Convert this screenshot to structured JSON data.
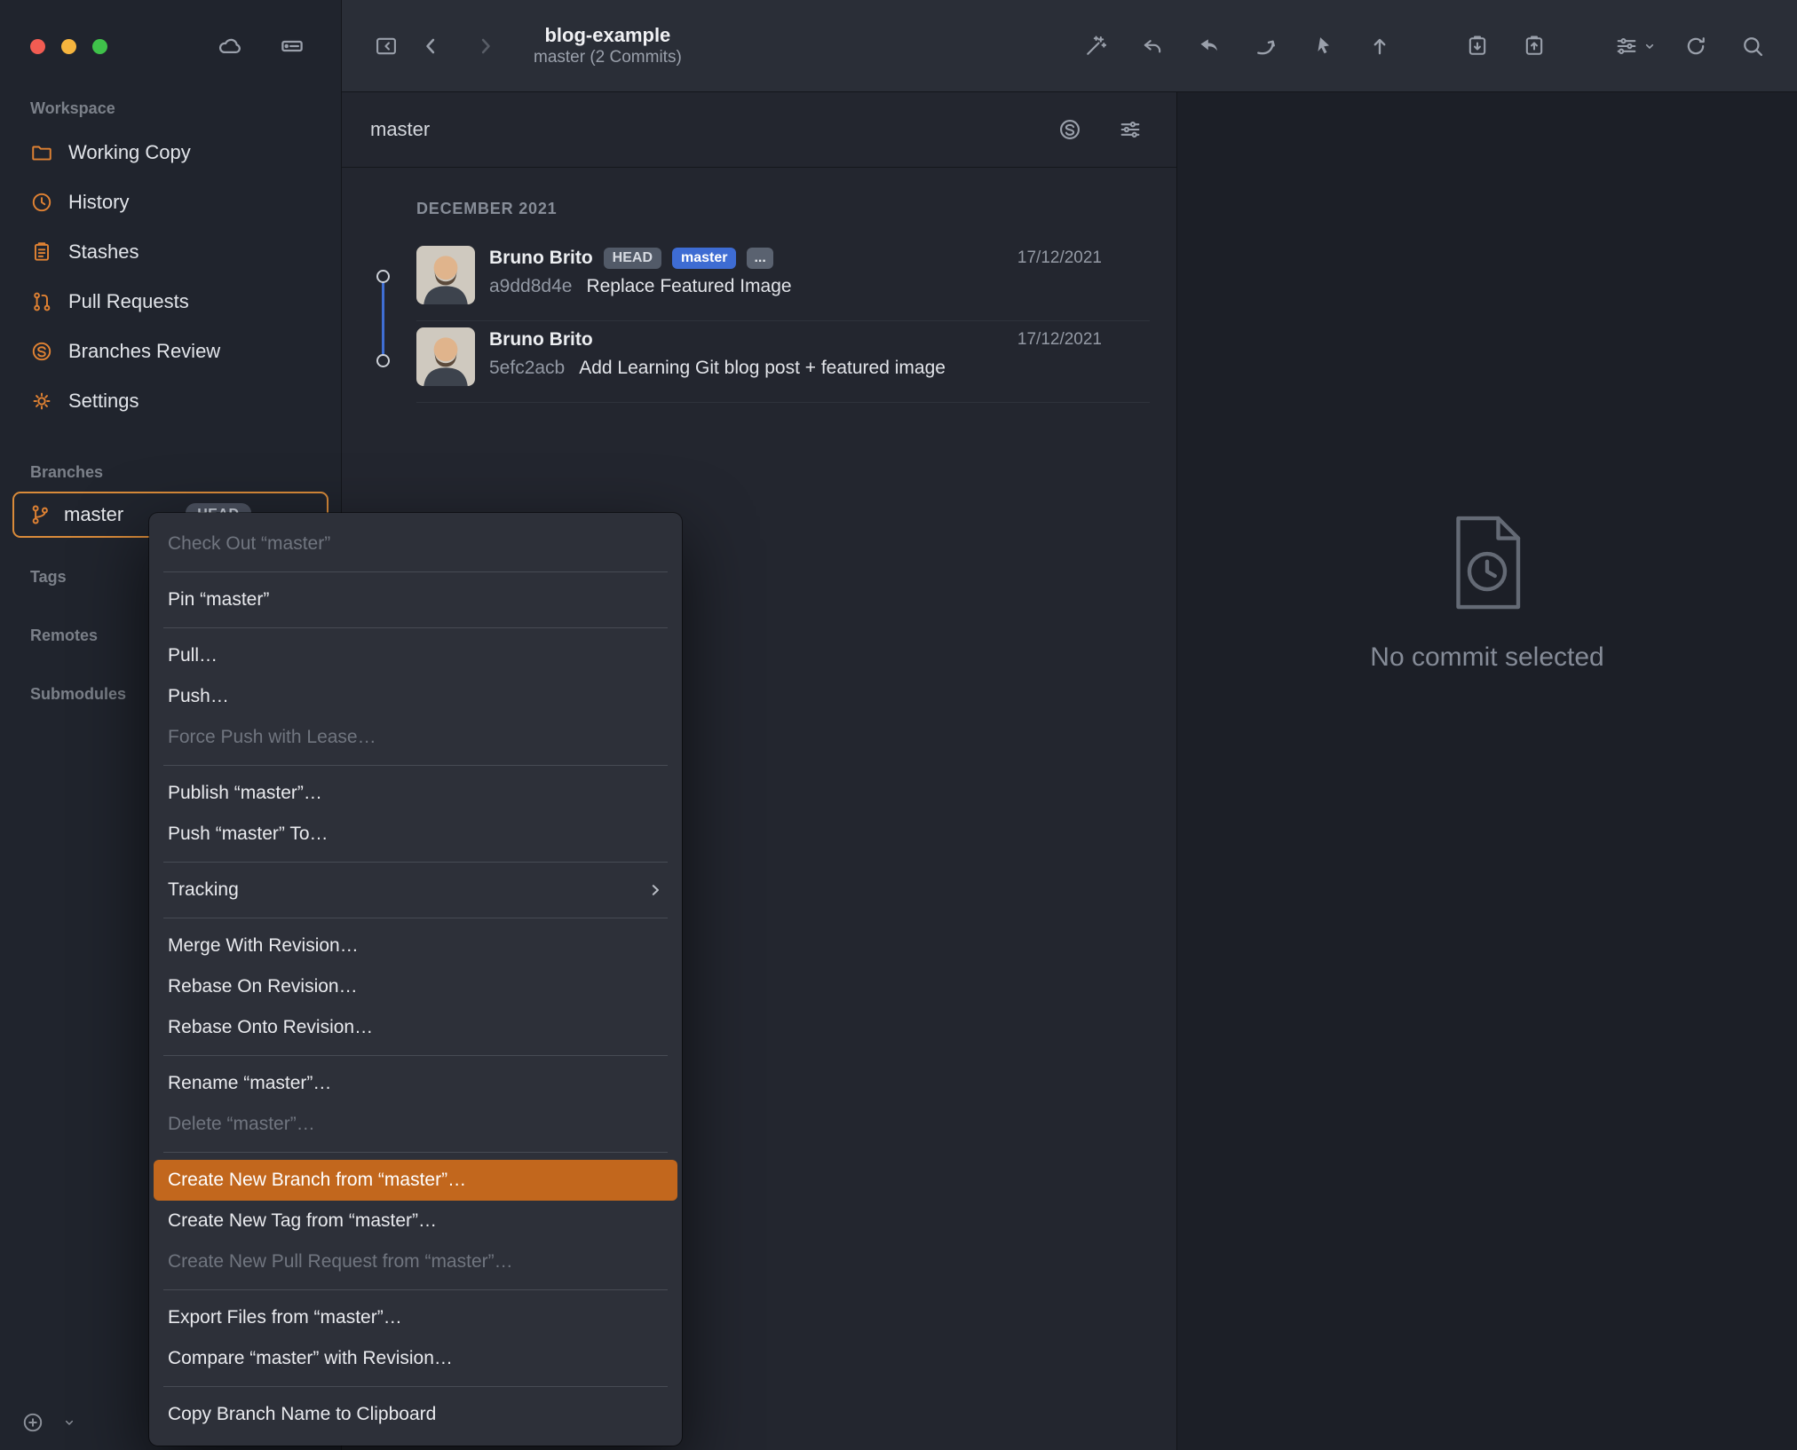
{
  "window": {
    "title": "blog-example",
    "subtitle": "master (2 Commits)"
  },
  "sidebar": {
    "sections": {
      "workspace": "Workspace",
      "branches": "Branches",
      "tags": "Tags",
      "remotes": "Remotes",
      "submodules": "Submodules"
    },
    "workspace_items": [
      {
        "label": "Working Copy",
        "icon": "folder-icon"
      },
      {
        "label": "History",
        "icon": "clock-icon"
      },
      {
        "label": "Stashes",
        "icon": "clipboard-icon"
      },
      {
        "label": "Pull Requests",
        "icon": "pull-request-icon"
      },
      {
        "label": "Branches Review",
        "icon": "branches-review-icon"
      },
      {
        "label": "Settings",
        "icon": "gear-icon"
      }
    ],
    "branch_row": {
      "name": "master",
      "badge": "HEAD"
    }
  },
  "commit_panel": {
    "filter_value": "master",
    "section_header": "DECEMBER 2021",
    "commits": [
      {
        "author": "Bruno Brito",
        "hash": "a9dd8d4e",
        "message": "Replace Featured Image",
        "date": "17/12/2021",
        "badges": {
          "head": "HEAD",
          "branch": "master",
          "more": "..."
        }
      },
      {
        "author": "Bruno Brito",
        "hash": "5efc2acb",
        "message": "Add Learning Git blog post + featured image",
        "date": "17/12/2021"
      }
    ]
  },
  "detail_panel": {
    "empty_message": "No commit selected"
  },
  "context_menu": {
    "items": [
      {
        "label": "Check Out “master”",
        "state": "disabled"
      },
      {
        "label": "Pin “master”",
        "state": "normal"
      },
      {
        "label": "Pull…",
        "state": "normal"
      },
      {
        "label": "Push…",
        "state": "normal"
      },
      {
        "label": "Force Push with Lease…",
        "state": "disabled"
      },
      {
        "label": "Publish “master”…",
        "state": "normal"
      },
      {
        "label": "Push “master” To…",
        "state": "normal"
      },
      {
        "label": "Tracking",
        "state": "submenu"
      },
      {
        "label": "Merge With Revision…",
        "state": "normal"
      },
      {
        "label": "Rebase On Revision…",
        "state": "normal"
      },
      {
        "label": "Rebase Onto Revision…",
        "state": "normal"
      },
      {
        "label": "Rename “master”…",
        "state": "normal"
      },
      {
        "label": "Delete “master”…",
        "state": "disabled"
      },
      {
        "label": "Create New Branch from “master”…",
        "state": "highlighted"
      },
      {
        "label": "Create New Tag from “master”…",
        "state": "normal"
      },
      {
        "label": "Create New Pull Request from “master”…",
        "state": "disabled"
      },
      {
        "label": "Export Files from “master”…",
        "state": "normal"
      },
      {
        "label": "Compare “master” with Revision…",
        "state": "normal"
      },
      {
        "label": "Copy Branch Name to Clipboard",
        "state": "normal"
      }
    ]
  },
  "colors": {
    "accent_orange": "#e08233",
    "menu_highlight": "#c2671d",
    "branch_badge_blue": "#3e6cd3",
    "selection_ring": "#d98b3a"
  }
}
